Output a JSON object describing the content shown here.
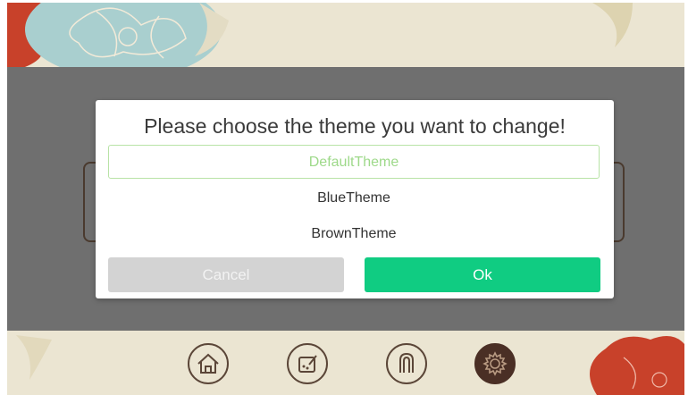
{
  "dialog": {
    "title": "Please choose the theme you want to change!",
    "options": [
      {
        "label": "DefaultTheme",
        "selected": true
      },
      {
        "label": "BlueTheme",
        "selected": false
      },
      {
        "label": "BrownTheme",
        "selected": false
      }
    ],
    "cancel_label": "Cancel",
    "ok_label": "Ok"
  },
  "nav": {
    "icons": [
      "home-icon",
      "paint-icon",
      "fingerprint-icon",
      "gear-icon"
    ],
    "active": "gear-icon"
  },
  "colors": {
    "accent": "#10cc82",
    "selected_option": "#9ed98a",
    "overlay": "#6f6f6f",
    "cancel": "#d3d3d3"
  }
}
